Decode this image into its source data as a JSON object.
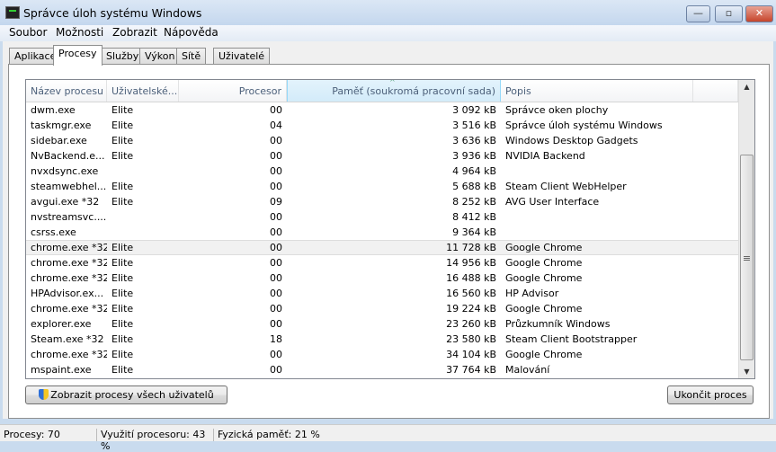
{
  "window": {
    "title": "Správce úloh systému Windows",
    "minimize": "—",
    "maximize": "▫",
    "close": "✕"
  },
  "menu": [
    "Soubor",
    "Možnosti",
    "Zobrazit",
    "Nápověda"
  ],
  "tabs": [
    "Aplikace",
    "Procesy",
    "Služby",
    "Výkon",
    "Sítě",
    "Uživatelé"
  ],
  "active_tab": "Procesy",
  "columns": [
    "Název procesu",
    "Uživatelské...",
    "Procesor",
    "Paměť (soukromá pracovní sada)",
    "Popis"
  ],
  "sort_indicator": "^",
  "rows": [
    [
      "dwm.exe",
      "Elite",
      "00",
      "3 092 kB",
      "Správce oken plochy"
    ],
    [
      "taskmgr.exe",
      "Elite",
      "04",
      "3 516 kB",
      "Správce úloh systému Windows"
    ],
    [
      "sidebar.exe",
      "Elite",
      "00",
      "3 636 kB",
      "Windows Desktop Gadgets"
    ],
    [
      "NvBackend.e...",
      "Elite",
      "00",
      "3 936 kB",
      "NVIDIA Backend"
    ],
    [
      "nvxdsync.exe",
      "",
      "00",
      "4 964 kB",
      ""
    ],
    [
      "steamwebhel...",
      "Elite",
      "00",
      "5 688 kB",
      "Steam Client WebHelper"
    ],
    [
      "avgui.exe *32",
      "Elite",
      "09",
      "8 252 kB",
      "AVG User Interface"
    ],
    [
      "nvstreamsvc....",
      "",
      "00",
      "8 412 kB",
      ""
    ],
    [
      "csrss.exe",
      "",
      "00",
      "9 364 kB",
      ""
    ],
    [
      "chrome.exe *32",
      "Elite",
      "00",
      "11 728 kB",
      "Google Chrome"
    ],
    [
      "chrome.exe *32",
      "Elite",
      "00",
      "14 956 kB",
      "Google Chrome"
    ],
    [
      "chrome.exe *32",
      "Elite",
      "00",
      "16 488 kB",
      "Google Chrome"
    ],
    [
      "HPAdvisor.ex...",
      "Elite",
      "00",
      "16 560 kB",
      "HP Advisor"
    ],
    [
      "chrome.exe *32",
      "Elite",
      "00",
      "19 224 kB",
      "Google Chrome"
    ],
    [
      "explorer.exe",
      "Elite",
      "00",
      "23 260 kB",
      "Průzkumník Windows"
    ],
    [
      "Steam.exe *32",
      "Elite",
      "18",
      "23 580 kB",
      "Steam Client Bootstrapper"
    ],
    [
      "chrome.exe *32",
      "Elite",
      "00",
      "34 104 kB",
      "Google Chrome"
    ],
    [
      "mspaint.exe",
      "Elite",
      "00",
      "37 764 kB",
      "Malování"
    ]
  ],
  "buttons": {
    "show_all": "Zobrazit procesy všech uživatelů",
    "end_process": "Ukončit proces"
  },
  "status": {
    "processes": "Procesy: 70",
    "cpu": "Využití procesoru: 43 %",
    "memory": "Fyzická paměť: 21 %"
  }
}
